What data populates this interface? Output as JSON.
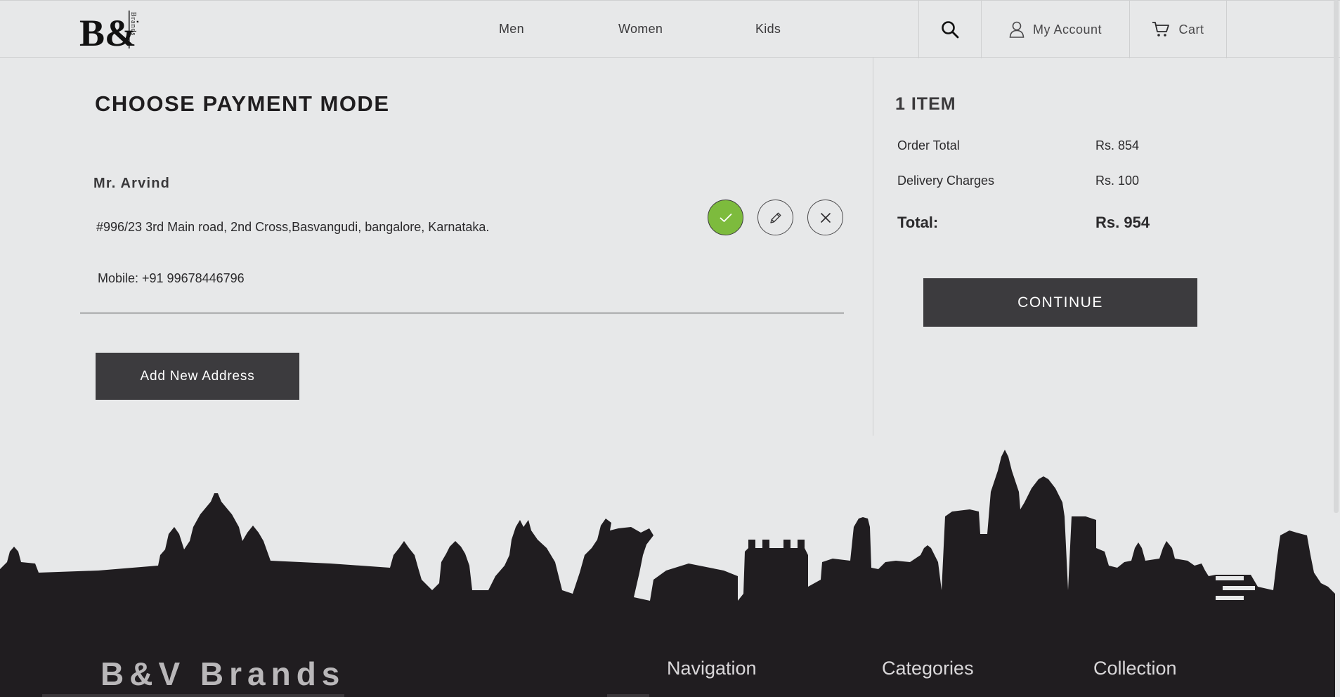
{
  "header": {
    "logo_text": "B&V",
    "logo_side_text": "Brands",
    "nav": [
      "Men",
      "Women",
      "Kids"
    ],
    "account_label": "My Account",
    "cart_label": "Cart"
  },
  "page": {
    "title": "CHOOSE PAYMENT MODE"
  },
  "address": {
    "name": "Mr. Arvind",
    "line": "#996/23 3rd Main road, 2nd Cross,Basvangudi, bangalore, Karnataka.",
    "mobile": "Mobile: +91 99678446796",
    "selected": true,
    "add_new_label": "Add New Address"
  },
  "summary": {
    "items_count": "1 ITEM",
    "rows": [
      {
        "label": "Order Total",
        "value": "Rs. 854"
      },
      {
        "label": "Delivery Charges",
        "value": "Rs. 100"
      }
    ],
    "total_label": "Total:",
    "total_value": "Rs. 954",
    "continue_label": "CONTINUE"
  },
  "footer": {
    "brand": "B&V Brands",
    "columns": [
      "Navigation",
      "Categories",
      "Collection"
    ]
  },
  "colors": {
    "background": "#e7e8e9",
    "dark": "#3c3b3e",
    "accent_green": "#7dbb3d",
    "footer": "#201d20"
  }
}
